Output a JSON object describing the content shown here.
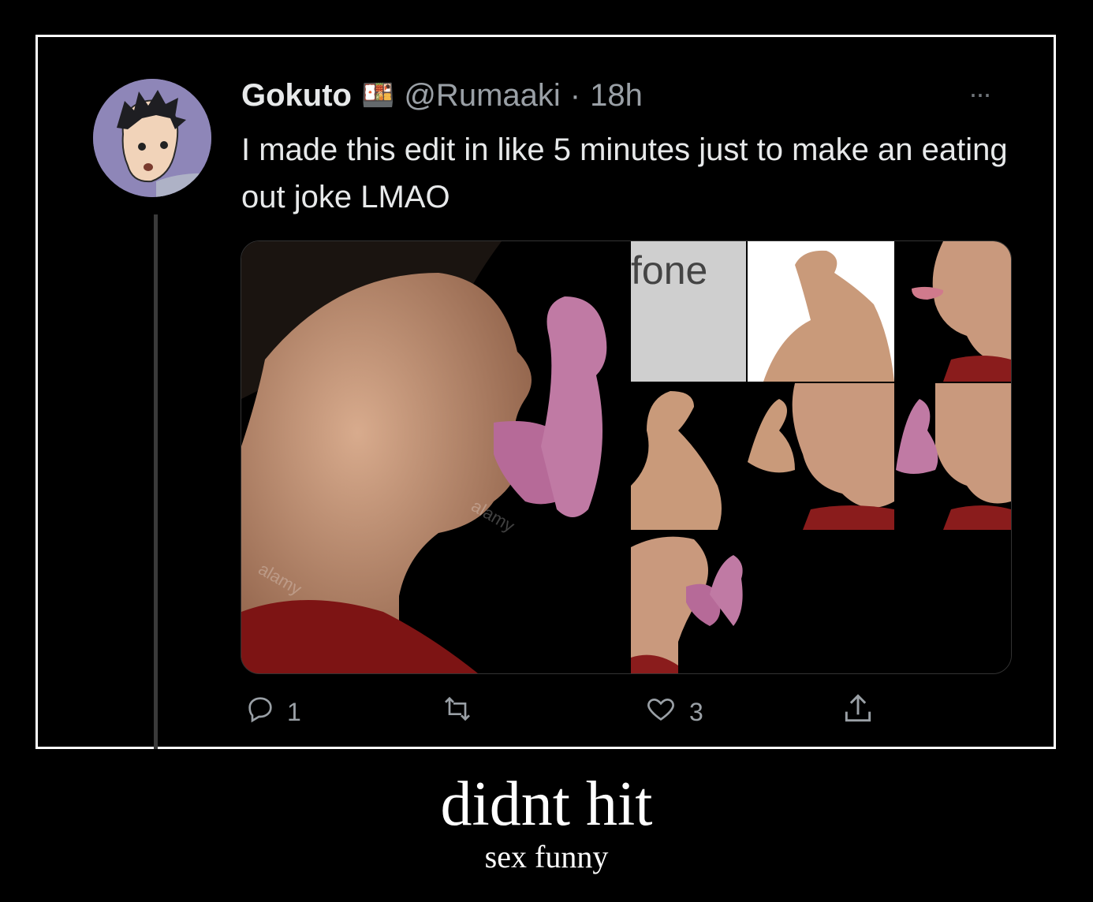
{
  "tweet": {
    "display_name": "Gokuto",
    "badge_emoji": "🍱",
    "handle": "@Rumaaki",
    "separator": "·",
    "time": "18h",
    "more_label": "···",
    "text": "I made this edit in like 5 minutes just to make an eating out joke LMAO",
    "media_fone_label": "fone",
    "watermark": "alamy",
    "actions": {
      "reply_count": "1",
      "retweet_count": "",
      "like_count": "3"
    }
  },
  "caption": {
    "title": "didnt hit",
    "subtitle": "sex funny"
  },
  "colors": {
    "background": "#000000",
    "frame_border": "#ffffff",
    "text_primary": "#e7e9ea",
    "text_secondary": "#9aa0a6",
    "avatar_bg": "#8e86b8",
    "shirt_red": "#8a1c1c",
    "skin": "#c99a7a",
    "tongue_pink": "#b66a98"
  },
  "icons": [
    "avatar",
    "bento-box-icon",
    "more-icon",
    "reply-icon",
    "retweet-icon",
    "like-icon",
    "share-icon"
  ]
}
